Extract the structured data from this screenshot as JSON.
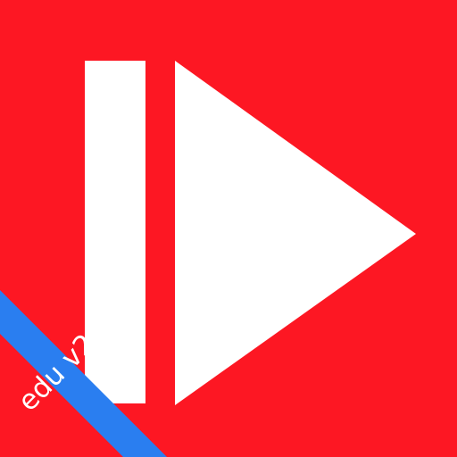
{
  "icon": {
    "name": "play-from-start",
    "background_color": "#fd1723",
    "glyph_color": "#ffffff"
  },
  "ribbon": {
    "label": "edu v2",
    "color": "#2a7ef0",
    "text_color": "#ffffff"
  }
}
